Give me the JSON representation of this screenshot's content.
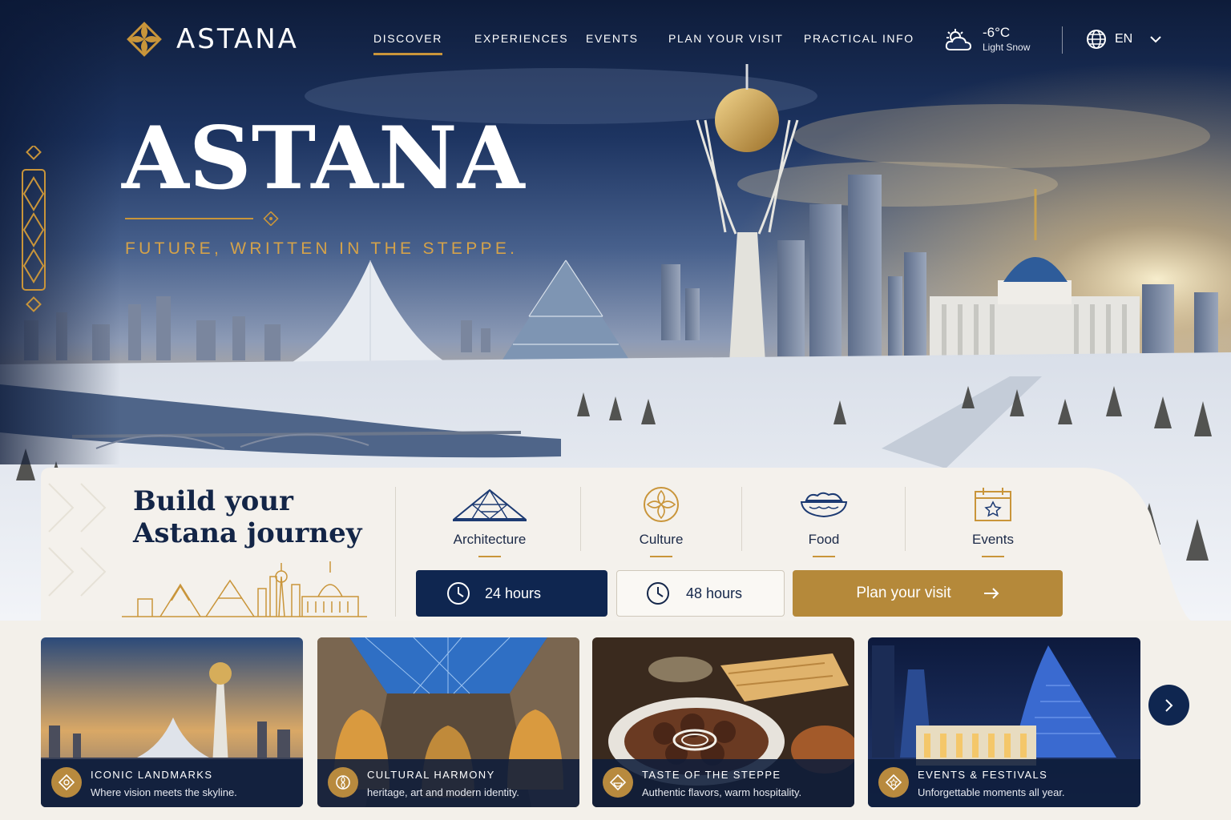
{
  "nav": {
    "brand": "ASTANA",
    "links": [
      "DISCOVER",
      "EXPERIENCES",
      "EVENTS",
      "PLAN YOUR VISIT",
      "PRACTICAL INFO"
    ],
    "active_link": "DISCOVER",
    "weather": {
      "temp": "-6°C",
      "desc": "Light Snow",
      "icon": "snow-cloud-icon"
    },
    "language": "EN"
  },
  "hero": {
    "title": "ASTANA",
    "tagline": "FUTURE, WRITTEN IN THE STEPPE."
  },
  "journey": {
    "title_line1": "Build your",
    "title_line2": "Astana journey",
    "categories": [
      {
        "label": "Architecture",
        "icon": "pyramid-icon"
      },
      {
        "label": "Culture",
        "icon": "ornament-icon"
      },
      {
        "label": "Food",
        "icon": "dish-icon"
      },
      {
        "label": "Events",
        "icon": "calendar-star-icon"
      }
    ],
    "durations": [
      "24 hours",
      "48 hours"
    ],
    "selected_duration": "24 hours",
    "cta": "Plan your visit"
  },
  "cards": [
    {
      "title": "ICONIC LANDMARKS",
      "subtitle": "Where vision meets the skyline."
    },
    {
      "title": "CULTURAL HARMONY",
      "subtitle": "heritage, art and modern identity."
    },
    {
      "title": "TASTE OF THE STEPPE",
      "subtitle": "Authentic flavors, warm hospitality."
    },
    {
      "title": "EVENTS & FESTIVALS",
      "subtitle": "Unforgettable moments all year."
    }
  ],
  "colors": {
    "navy": "#0f2650",
    "gold": "#c9953a",
    "cream": "#f3f0ea"
  }
}
